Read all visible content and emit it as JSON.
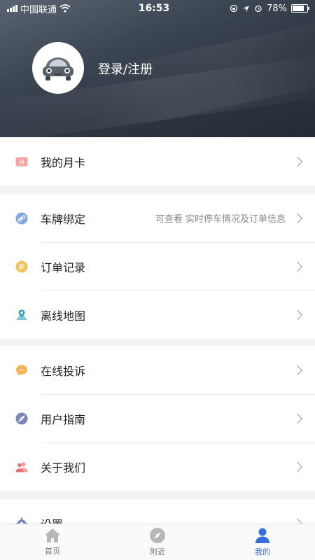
{
  "status_bar": {
    "carrier": "中国联通",
    "time": "16:53",
    "battery": "78%",
    "battery_fraction": 0.78
  },
  "profile": {
    "login_text": "登录/注册"
  },
  "menu_sections": [
    {
      "items": [
        {
          "id": "monthly-card",
          "icon": "monthly-card-icon",
          "label": "我的月卡",
          "hint": ""
        }
      ]
    },
    {
      "items": [
        {
          "id": "plate-binding",
          "icon": "link-icon",
          "label": "车牌绑定",
          "hint": "可查看 实时停车情况及订单信息"
        },
        {
          "id": "order-records",
          "icon": "order-list-icon",
          "label": "订单记录",
          "hint": ""
        },
        {
          "id": "offline-map",
          "icon": "map-pin-icon",
          "label": "离线地图",
          "hint": ""
        }
      ]
    },
    {
      "items": [
        {
          "id": "online-complaint",
          "icon": "chat-bubble-icon",
          "label": "在线投诉",
          "hint": ""
        },
        {
          "id": "user-guide",
          "icon": "compass-icon",
          "label": "用户指南",
          "hint": ""
        },
        {
          "id": "about-us",
          "icon": "people-icon",
          "label": "关于我们",
          "hint": ""
        }
      ]
    },
    {
      "items": [
        {
          "id": "settings",
          "icon": "gear-icon",
          "label": "设置",
          "hint": ""
        }
      ]
    }
  ],
  "tabbar": [
    {
      "id": "home",
      "icon": "home-icon",
      "label": "首页",
      "active": false
    },
    {
      "id": "nearby",
      "icon": "compass-icon",
      "label": "附近",
      "active": false
    },
    {
      "id": "mine",
      "icon": "user-icon",
      "label": "我的",
      "active": true
    }
  ],
  "colors": {
    "accent": "#3a6fd8",
    "header_dark": "#2d3540"
  }
}
